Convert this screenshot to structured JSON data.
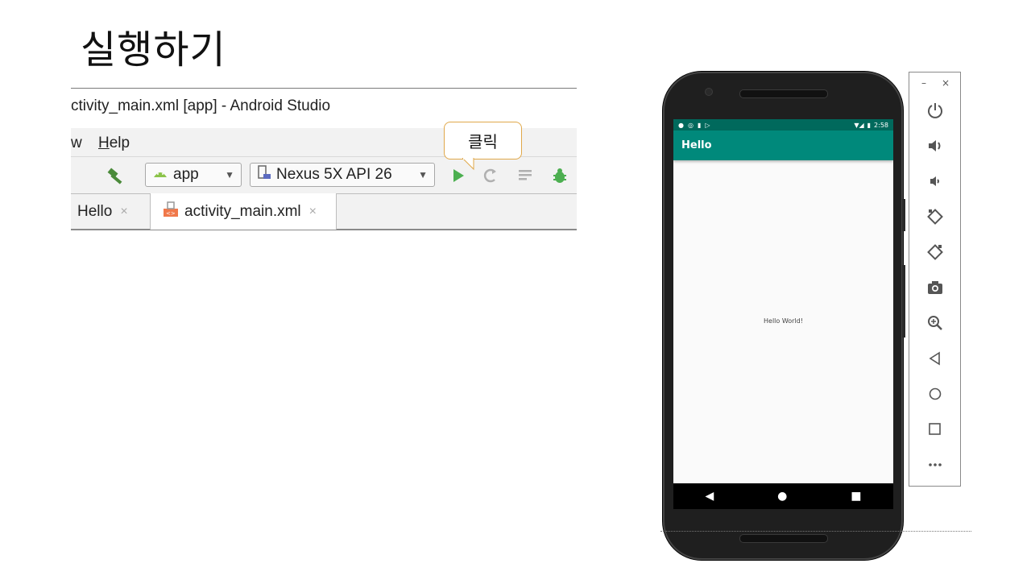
{
  "slide": {
    "title": "실행하기"
  },
  "studio": {
    "window_title": "ctivity_main.xml [app] - Android Studio",
    "menu": {
      "view_partial": "w",
      "help_prefix": "H",
      "help_rest": "elp"
    },
    "toolbar": {
      "run_config": "app",
      "device": "Nexus 5X API 26"
    },
    "tabs": [
      {
        "label": "Hello",
        "close": "×"
      },
      {
        "label": "activity_main.xml",
        "close": "×"
      }
    ],
    "callout": "클릭"
  },
  "phone": {
    "status_time": "2:58",
    "app_title": "Hello",
    "content_text": "Hello World!"
  },
  "emulator_panel": {
    "minimize": "–",
    "close": "×",
    "buttons": [
      "power-icon",
      "volume-up-icon",
      "volume-down-icon",
      "rotate-left-icon",
      "rotate-right-icon",
      "camera-icon",
      "zoom-icon",
      "back-icon",
      "home-icon",
      "overview-icon",
      "more-icon"
    ]
  },
  "colors": {
    "accent": "#00897b",
    "status": "#00695c",
    "run_green": "#4caf50",
    "callout_border": "#e0a84a"
  }
}
